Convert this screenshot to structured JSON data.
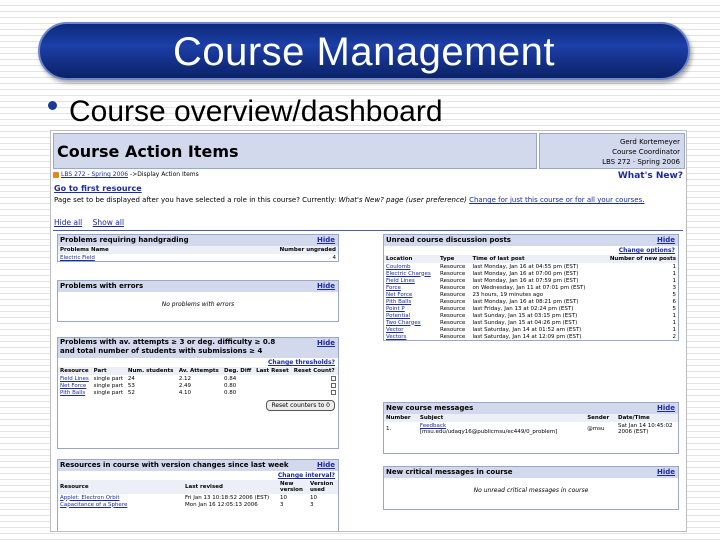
{
  "slide": {
    "title": "Course Management",
    "bullet": "Course overview/dashboard"
  },
  "screenshot": {
    "header_title": "Course Action Items",
    "side_name": "Gerd Kortemeyer",
    "side_role": "Course Coordinator",
    "side_course": "LBS 272 · Spring 2006",
    "breadcrumb_course": "LBS 272 - Spring 2006",
    "breadcrumb_page": "->Display Action Items",
    "whats_new": "What's New?",
    "first_resource": "Go to first resource",
    "page_set_text": "Page set to be displayed after you have selected a role in this course? Currently:",
    "page_set_current": "What's New? page (user preference)",
    "page_set_change": "Change for just this course or for all your courses.",
    "hide_all": "Hide all",
    "show_all": "Show all",
    "hide": "Hide",
    "handgrading": {
      "title": "Problems requiring handgrading",
      "col_name": "Problems Name",
      "col_num": "Number ungraded",
      "rows": [
        {
          "name": "Electric Field",
          "num": "4"
        }
      ]
    },
    "errors": {
      "title": "Problems with errors",
      "empty": "No problems with errors"
    },
    "attempts": {
      "title_line1": "Problems with av. attempts ≥ 3 or deg. difficulty ≥ 0.8",
      "title_line2": "and total number of students with submissions ≥ 4",
      "change": "Change thresholds?",
      "headers": [
        "Resource",
        "Part",
        "Num. students",
        "Av. Attempts",
        "Deg. Diff",
        "Last Reset",
        "Reset Count?"
      ],
      "rows": [
        {
          "res": "Field Lines",
          "part": "single part",
          "num": "24",
          "att": "2.12",
          "diff": "0.84"
        },
        {
          "res": "Net Force",
          "part": "single part",
          "num": "53",
          "att": "2.49",
          "diff": "0.80"
        },
        {
          "res": "Pith Balls",
          "part": "single part",
          "num": "52",
          "att": "4.10",
          "diff": "0.80"
        }
      ],
      "reset_button": "Reset counters to 0"
    },
    "versions": {
      "title": "Resources in course with version changes since last week",
      "change": "Change interval?",
      "headers": [
        "Resource",
        "Last revised",
        "New version",
        "Version used"
      ],
      "rows": [
        {
          "res": "Applet: Electron Orbit",
          "rev": "Fri Jan 13 10:18:52 2006 (EST)",
          "new": "10",
          "used": "10"
        },
        {
          "res": "Capacitance of a Sphere",
          "rev": "Mon Jan 16 12:05:13 2006",
          "new": "3",
          "used": "3"
        }
      ]
    },
    "discussion": {
      "title": "Unread course discussion posts",
      "change": "Change options?",
      "headers": [
        "Location",
        "Type",
        "Time of last post",
        "Number of new posts"
      ],
      "rows": [
        {
          "loc": "Coulomb",
          "type": "Resource",
          "time": "last Monday, Jan 16 at 04:55 pm (EST)",
          "num": "1"
        },
        {
          "loc": "Electric Charges",
          "type": "Resource",
          "time": "last Monday, Jan 16 at 07:00 pm (EST)",
          "num": "1"
        },
        {
          "loc": "Field Lines",
          "type": "Resource",
          "time": "last Monday, Jan 16 at 07:59 pm (EST)",
          "num": "1"
        },
        {
          "loc": "Force",
          "type": "Resource",
          "time": "on Wednesday, Jan 11 at 07:01 pm (EST)",
          "num": "3"
        },
        {
          "loc": "Net Force",
          "type": "Resource",
          "time": "23 hours, 19 minutes ago",
          "num": "5"
        },
        {
          "loc": "Pith Balls",
          "type": "Resource",
          "time": "last Monday, Jan 16 at 08:21 pm (EST)",
          "num": "6"
        },
        {
          "loc": "Point P",
          "type": "Resource",
          "time": "last Friday, Jan 13 at 02:24 pm (EST)",
          "num": "5"
        },
        {
          "loc": "Potential",
          "type": "Resource",
          "time": "last Sunday, Jan 15 at 03:15 pm (EST)",
          "num": "1"
        },
        {
          "loc": "Two Charges",
          "type": "Resource",
          "time": "last Sunday, Jan 15 at 04:26 pm (EST)",
          "num": "1"
        },
        {
          "loc": "Vector",
          "type": "Resource",
          "time": "last Saturday, Jan 14 at 01:52 am (EST)",
          "num": "1"
        },
        {
          "loc": "Vectors",
          "type": "Resource",
          "time": "last Saturday, Jan 14 at 12:09 pm (EST)",
          "num": "2"
        }
      ]
    },
    "messages": {
      "title": "New course messages",
      "headers": [
        "Number",
        "Subject",
        "Sender",
        "Date/Time"
      ],
      "rows": [
        {
          "num": "1.",
          "subject": "Feedback",
          "sub2": "[msu.edu/udaqy16@publicmsu/ec449/0_problem]",
          "sender": "@msu",
          "date": "Sat Jan 14 10:45:02 2006 (EST)"
        }
      ]
    },
    "critical": {
      "title": "New critical messages in course",
      "empty": "No unread critical messages in course"
    }
  }
}
